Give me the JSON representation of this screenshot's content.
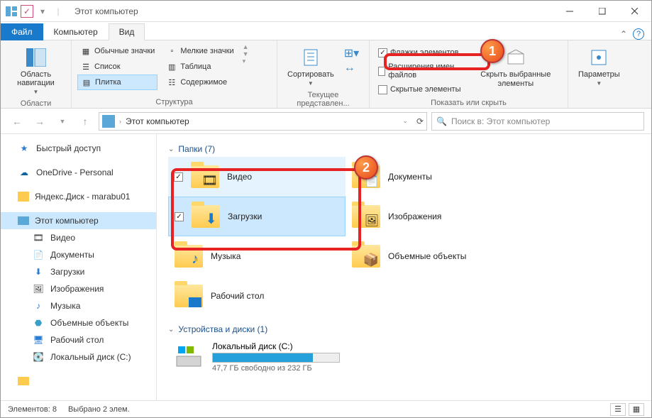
{
  "title": "Этот компьютер",
  "tabs": {
    "file": "Файл",
    "computer": "Компьютер",
    "view": "Вид"
  },
  "ribbon": {
    "panes": {
      "navigation_pane": "Область навигации",
      "panes_label": "Области"
    },
    "layout": {
      "regular_icons": "Обычные значки",
      "small_icons": "Мелкие значки",
      "list": "Список",
      "table": "Таблица",
      "tiles": "Плитка",
      "content": "Содержимое",
      "group_label": "Структура"
    },
    "current_view": {
      "sort": "Сортировать",
      "group_label": "Текущее представлен..."
    },
    "show_hide": {
      "item_checkboxes": "Флажки элементов",
      "filename_extensions": "Расширения имен файлов",
      "hidden_items": "Скрытые элементы",
      "hide_selected": "Скрыть выбранные элементы",
      "group_label": "Показать или скрыть"
    },
    "options": "Параметры"
  },
  "address": {
    "location": "Этот компьютер",
    "search_placeholder": "Поиск в: Этот компьютер"
  },
  "nav": {
    "quick_access": "Быстрый доступ",
    "onedrive": "OneDrive - Personal",
    "yandex": "Яндекс.Диск - marabu01",
    "this_pc": "Этот компьютер",
    "videos": "Видео",
    "documents": "Документы",
    "downloads": "Загрузки",
    "pictures": "Изображения",
    "music": "Музыка",
    "objects3d": "Объемные объекты",
    "desktop": "Рабочий стол",
    "localdisk": "Локальный диск (C:)"
  },
  "content": {
    "folders_header": "Папки (7)",
    "devices_header": "Устройства и диски (1)",
    "folders": {
      "videos": "Видео",
      "documents": "Документы",
      "downloads": "Загрузки",
      "pictures": "Изображения",
      "music": "Музыка",
      "objects3d": "Объемные объекты",
      "desktop": "Рабочий стол"
    },
    "drive": {
      "name": "Локальный диск (C:)",
      "sub": "47,7 ГБ свободно из 232 ГБ"
    }
  },
  "status": {
    "items": "Элементов: 8",
    "selected": "Выбрано 2 элем."
  }
}
